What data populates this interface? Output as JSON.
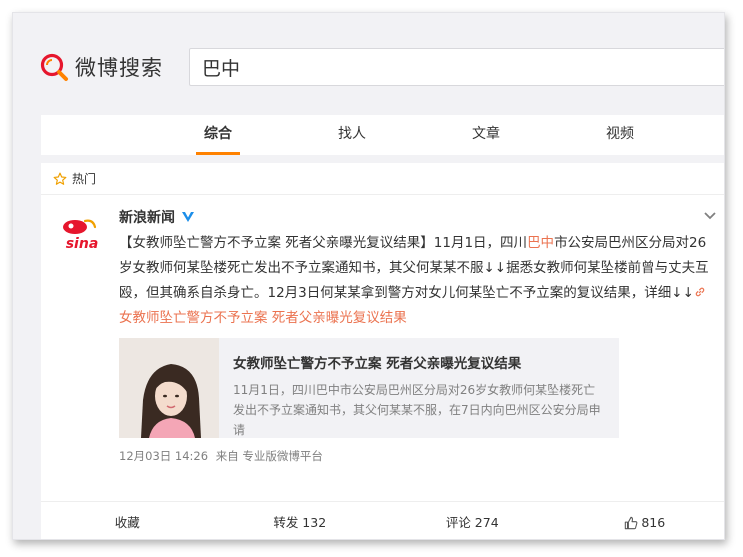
{
  "header": {
    "logo_text": "微博搜索",
    "search_value": "巴中"
  },
  "tabs": [
    {
      "label": "综合",
      "active": true
    },
    {
      "label": "找人",
      "active": false
    },
    {
      "label": "文章",
      "active": false
    },
    {
      "label": "视频",
      "active": false
    }
  ],
  "hot_label": "热门",
  "post": {
    "author": "新浪新闻",
    "avatar_text": "sina",
    "text_segments": {
      "s1": "【女教师坠亡警方不予立案 死者父亲曝光复议结果】11月1日，四川",
      "s2": "巴中",
      "s3": "市公安局巴州区分局对26岁女教师何某坠楼死亡发出不予立案通知书，其父何某某不服↓↓据悉女教师何某坠楼前曾与丈夫互殴，但其确系自杀身亡。12月3日何某某拿到警方对女儿何某坠亡不予立案的复议结果，详细↓↓",
      "link": "女教师坠亡警方不予立案 死者父亲曝光复议结果"
    },
    "share_card": {
      "title": "女教师坠亡警方不予立案 死者父亲曝光复议结果",
      "desc": "11月1日，四川巴中市公安局巴州区分局对26岁女教师何某坠楼死亡发出不予立案通知书，其父何某某不服，在7日内向巴州区公安分局申请"
    },
    "time": "12月03日 14:26",
    "source": "来自 专业版微博平台"
  },
  "actions": {
    "favorite": "收藏",
    "repost": "转发 132",
    "comment": "评论 274",
    "like": "816"
  },
  "colors": {
    "accent": "#ff8200",
    "highlight": "#eb7350",
    "verified": "#1c8ee9",
    "sina_red": "#e6162d"
  }
}
